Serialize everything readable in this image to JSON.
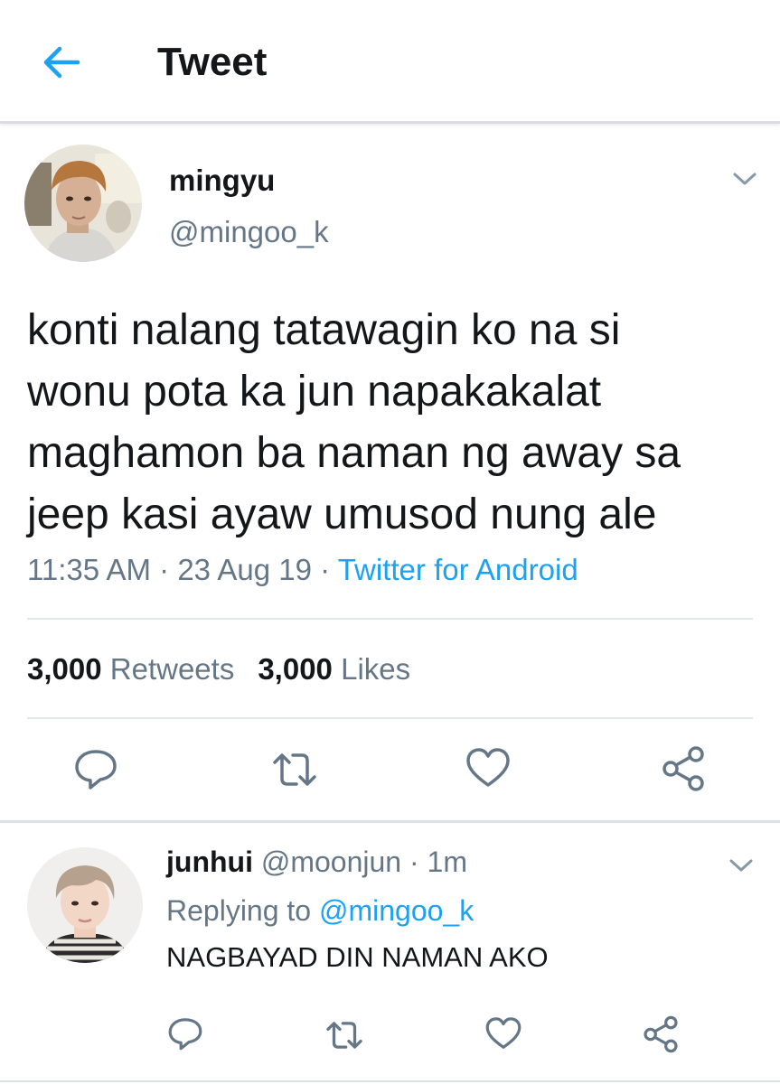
{
  "header": {
    "title": "Tweet",
    "back_icon": "arrow-left-icon",
    "accent_color": "#1da1f2"
  },
  "tweet": {
    "author_name": "mingyu",
    "author_handle": "@mingoo_k",
    "text": "konti nalang tatawagin ko na si\nwonu pota ka jun napakakalat\nmaghamon ba naman ng away sa\njeep kasi ayaw umusod nung ale",
    "time": "11:35 AM",
    "date": "23 Aug 19",
    "source": "Twitter for Android",
    "retweets_count": "3,000",
    "retweets_label": "Retweets",
    "likes_count": "3,000",
    "likes_label": "Likes",
    "actions": [
      "reply-icon",
      "retweet-icon",
      "like-icon",
      "share-icon"
    ]
  },
  "reply": {
    "author_name": "junhui",
    "author_handle": "@moonjun",
    "time_ago": "1m",
    "replying_label": "Replying to",
    "replying_to": "@mingoo_k",
    "text": "NAGBAYAD DIN NAMAN AKO",
    "actions": [
      "reply-icon",
      "retweet-icon",
      "like-icon",
      "share-icon"
    ]
  },
  "colors": {
    "text": "#14171a",
    "secondary": "#657786",
    "link": "#1da1f2",
    "divider": "#e1e8ed"
  }
}
